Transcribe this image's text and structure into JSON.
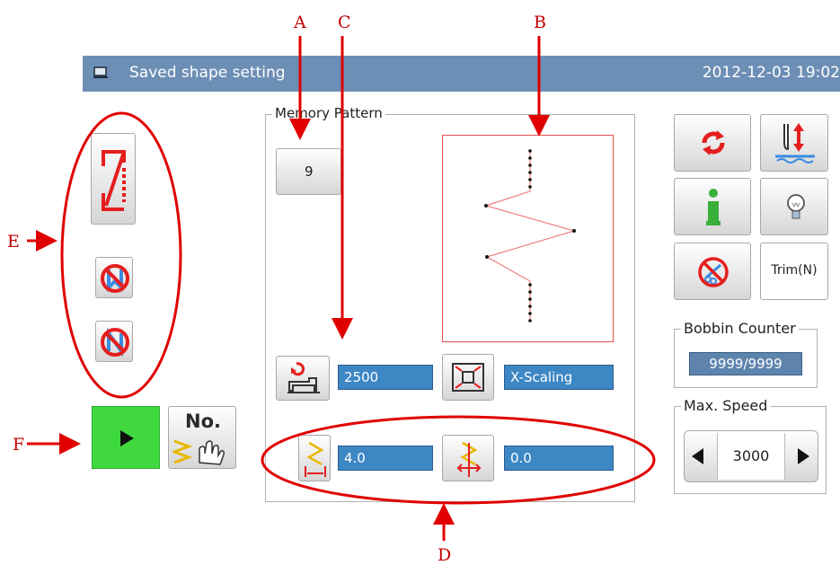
{
  "callouts": {
    "a": "A",
    "b": "B",
    "c": "C",
    "d": "D",
    "e": "E",
    "f": "F"
  },
  "titlebar": {
    "title": "Saved shape setting",
    "datetime": "2012-12-03  19:02"
  },
  "memory_pattern": {
    "label": "Memory Pattern",
    "pattern_number": "9",
    "stitch_count": "2500",
    "scaling_mode": "X-Scaling",
    "x_scale": "4.0",
    "y_offset": "0.0"
  },
  "right_panel": {
    "trim_label": "Trim(N)"
  },
  "bobbin_counter": {
    "label": "Bobbin Counter",
    "value": "9999/9999"
  },
  "max_speed": {
    "label": "Max. Speed",
    "value": "3000"
  },
  "bottom_left": {
    "no_label": "No."
  },
  "colors": {
    "titlebar": "#6d8fb6",
    "field": "#3d87c4",
    "annotation": "#e00000",
    "play": "#3fd93f"
  }
}
